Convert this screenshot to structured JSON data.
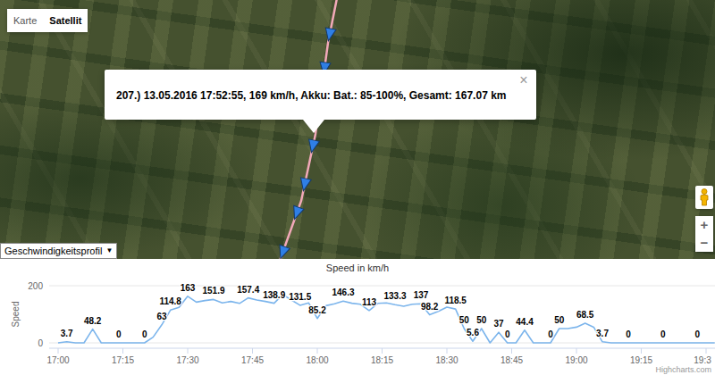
{
  "map": {
    "type_buttons": [
      {
        "label": "Karte",
        "selected": false
      },
      {
        "label": "Satellit",
        "selected": true
      }
    ],
    "popup": {
      "text": "207.) 13.05.2016 17:52:55, 169 km/h, Akku: Bat.: 85-100%, Gesamt: 167.07 km",
      "close": "×"
    },
    "zoom_buttons": [
      "+",
      "−"
    ]
  },
  "profile_select": {
    "value": "Geschwindigkeitsprofil",
    "arrow": "▼"
  },
  "chart": {
    "title": "Speed in km/h",
    "y_axis_title": "Speed",
    "y_ticks": [
      "0",
      "200"
    ],
    "x_ticks": [
      "17:00",
      "17:15",
      "17:30",
      "17:45",
      "18:00",
      "18:15",
      "18:30",
      "18:45",
      "19:00",
      "19:15",
      "19:3"
    ],
    "series": [
      {
        "values": [
          0,
          3.7,
          0,
          0,
          48.2,
          0,
          0,
          0,
          0,
          0,
          0,
          20,
          63,
          114.8,
          124.1,
          163,
          142.6,
          148.2,
          151.9,
          140,
          145,
          138,
          157.4,
          150,
          145,
          138.9,
          169,
          150,
          131.5,
          140,
          85.2,
          130,
          137,
          146.3,
          138.9,
          135,
          113,
          138,
          140,
          133.3,
          128,
          135,
          137,
          98.2,
          110,
          125,
          118.5,
          50,
          5.6,
          50,
          0,
          37,
          0,
          0,
          44.4,
          0,
          0,
          0,
          50,
          50,
          55,
          68.5,
          55,
          3.7,
          0,
          0,
          0,
          0,
          0,
          0,
          0,
          0,
          0,
          0,
          0,
          0,
          0
        ]
      }
    ],
    "data_labels": [
      {
        "text": "3.7",
        "index": 1
      },
      {
        "text": "48.2",
        "index": 4
      },
      {
        "text": "0",
        "index": 7
      },
      {
        "text": "0",
        "index": 10
      },
      {
        "text": "63",
        "index": 12
      },
      {
        "text": "114.8",
        "index": 13
      },
      {
        "text": "163",
        "index": 15
      },
      {
        "text": "151.9",
        "index": 18
      },
      {
        "text": "157.4",
        "index": 22
      },
      {
        "text": "138.9",
        "index": 25
      },
      {
        "text": "131.5",
        "index": 28
      },
      {
        "text": "85.2",
        "index": 30
      },
      {
        "text": "146.3",
        "index": 33
      },
      {
        "text": "113",
        "index": 36
      },
      {
        "text": "133.3",
        "index": 39
      },
      {
        "text": "137",
        "index": 42
      },
      {
        "text": "98.2",
        "index": 43
      },
      {
        "text": "118.5",
        "index": 46
      },
      {
        "text": "50",
        "index": 47
      },
      {
        "text": "5.6",
        "index": 48
      },
      {
        "text": "50",
        "index": 49
      },
      {
        "text": "37",
        "index": 51
      },
      {
        "text": "0",
        "index": 52
      },
      {
        "text": "44.4",
        "index": 54
      },
      {
        "text": "0",
        "index": 57
      },
      {
        "text": "50",
        "index": 58
      },
      {
        "text": "68.5",
        "index": 61
      },
      {
        "text": "3.7",
        "index": 63
      },
      {
        "text": "0",
        "index": 66
      },
      {
        "text": "0",
        "index": 70
      },
      {
        "text": "0",
        "index": 74
      }
    ],
    "credits": "Highcharts.com"
  }
}
